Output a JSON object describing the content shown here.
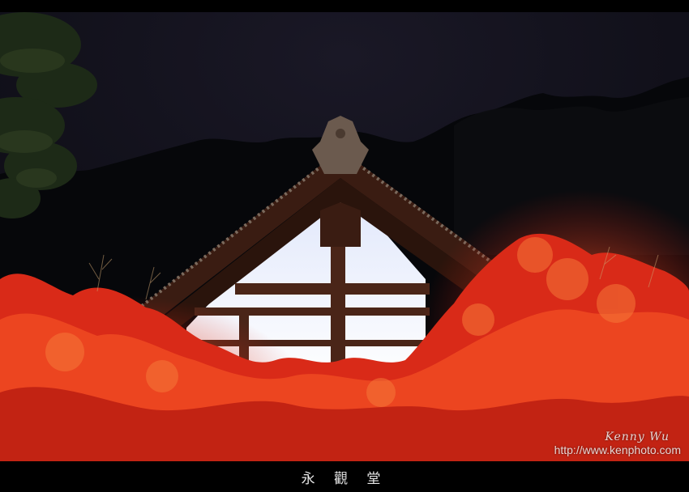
{
  "photo": {
    "caption": "永 觀 堂",
    "watermark_signature": "Kenny Wu",
    "watermark_url": "http://www.kenphoto.com",
    "colors": {
      "sky": "#12111c",
      "forest": "#07080a",
      "roof": "#3a1c12",
      "beam": "#4a2518",
      "wall": "#eef1fb",
      "maple": "#e0301a",
      "maple_light": "#f25a28",
      "pine": "#1d2a17"
    }
  }
}
